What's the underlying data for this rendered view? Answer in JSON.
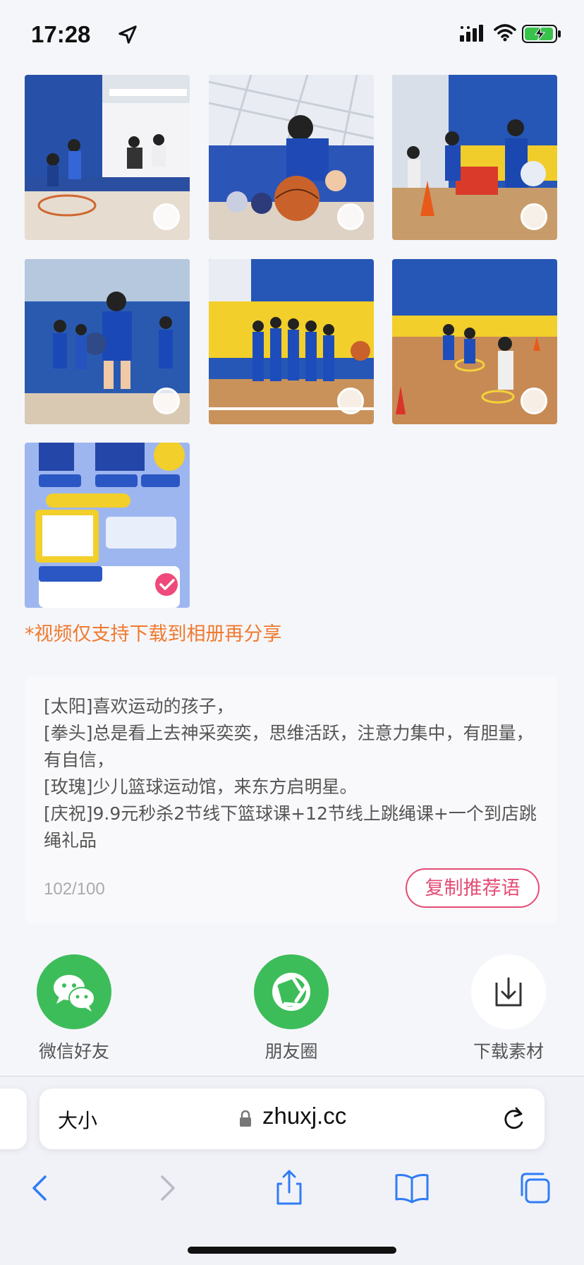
{
  "status_bar": {
    "time": "17:28"
  },
  "photos": [
    {
      "id": "photo-1",
      "selected": false
    },
    {
      "id": "photo-2",
      "selected": false
    },
    {
      "id": "photo-3",
      "selected": false
    },
    {
      "id": "photo-4",
      "selected": false
    },
    {
      "id": "photo-5",
      "selected": false
    },
    {
      "id": "photo-6",
      "selected": false
    },
    {
      "id": "photo-7",
      "selected": true
    }
  ],
  "video_note": "*视频仅支持下载到相册再分享",
  "caption": {
    "text": "[太阳]喜欢运动的孩子，\n[拳头]总是看上去神采奕奕，思维活跃，注意力集中，有胆量，有自信，\n[玫瑰]少儿篮球运动馆，来东方启明星。\n[庆祝]9.9元秒杀2节线下篮球课+12节线上跳绳课+一个到店跳绳礼品",
    "char_count": "102/100",
    "copy_button": "复制推荐语"
  },
  "share": {
    "wechat_friends": "微信好友",
    "moments": "朋友圈",
    "download": "下载素材"
  },
  "browser": {
    "text_size": "大小",
    "url": "zhuxj.cc"
  },
  "colors": {
    "accent_pink": "#e44c74",
    "note_orange": "#f0792e",
    "wechat_green": "#3dbd5a"
  }
}
